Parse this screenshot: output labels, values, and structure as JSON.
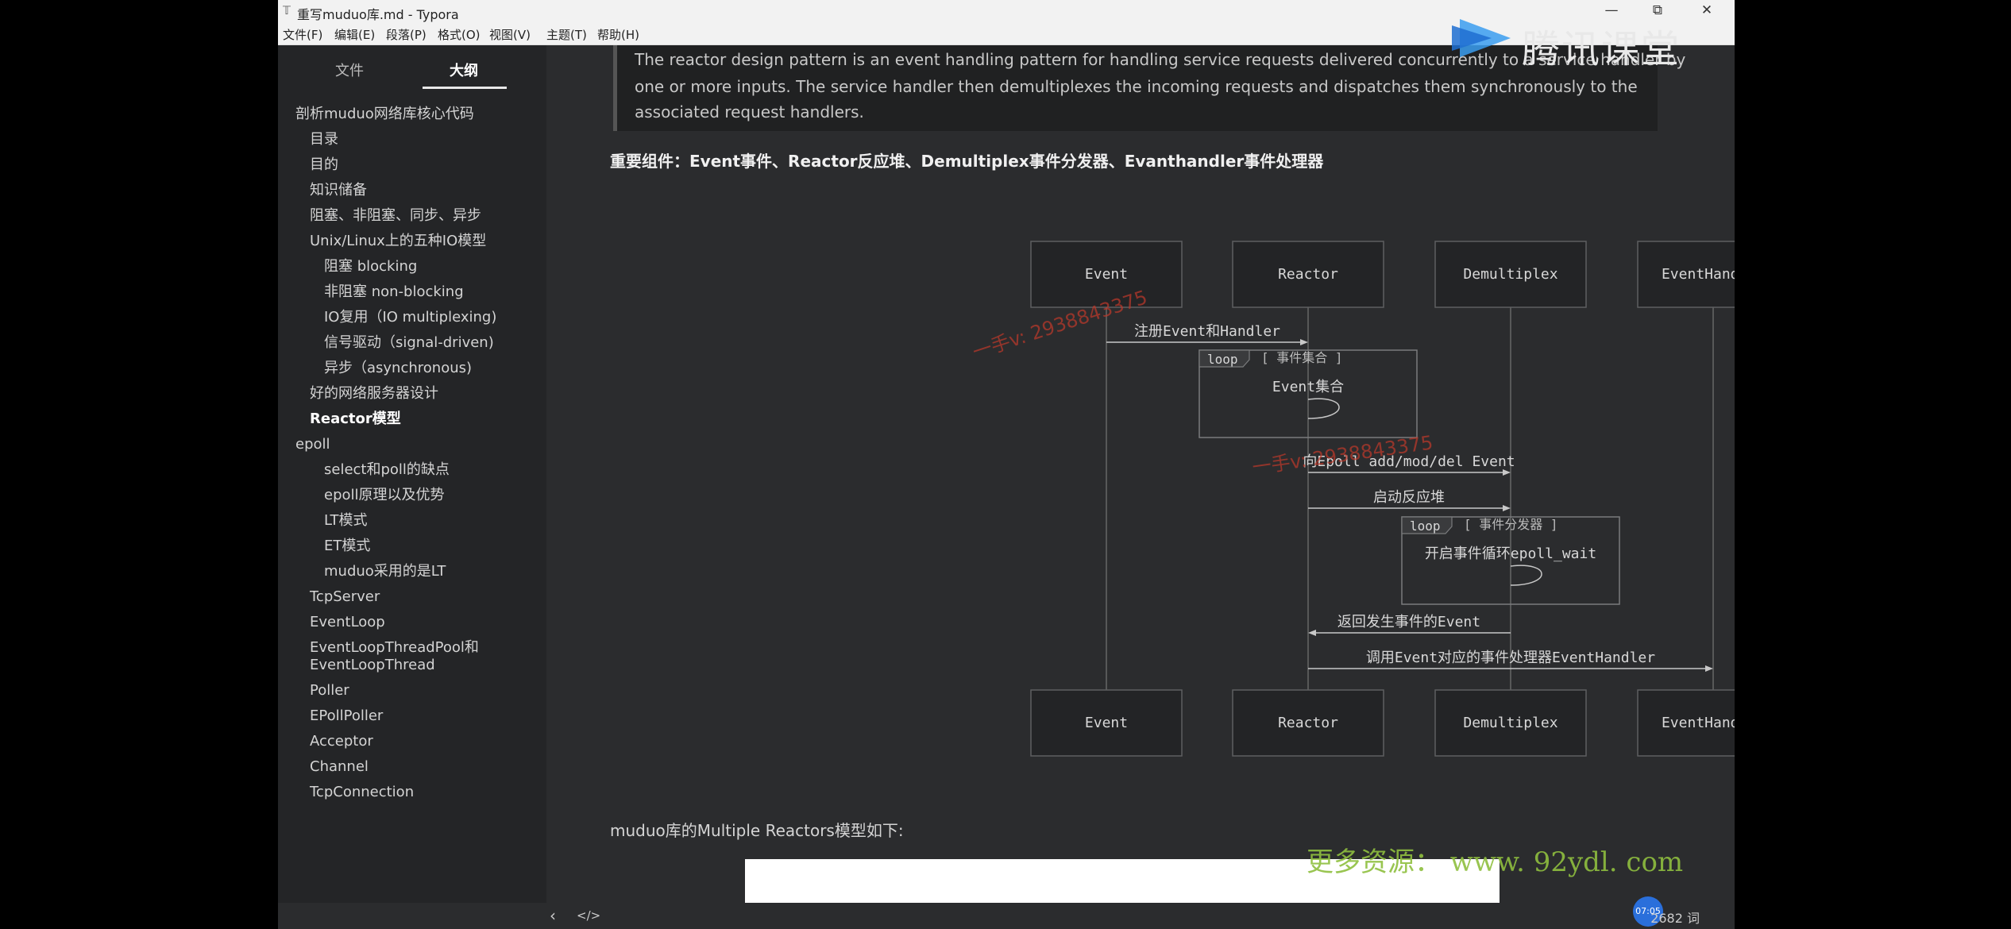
{
  "window": {
    "title": "重写muduo库.md - Typora",
    "minimize": "—",
    "maximize": "⧉",
    "close": "✕"
  },
  "menu": [
    "文件(F)",
    "编辑(E)",
    "段落(P)",
    "格式(O)",
    "视图(V)",
    "主题(T)",
    "帮助(H)"
  ],
  "sidebar": {
    "tabs": [
      "文件",
      "大纲"
    ],
    "active_tab": "大纲",
    "items": [
      {
        "label": "剖析muduo网络库核心代码",
        "level": 1
      },
      {
        "label": "目录",
        "level": 2
      },
      {
        "label": "目的",
        "level": 2
      },
      {
        "label": "知识储备",
        "level": 2
      },
      {
        "label": "阻塞、非阻塞、同步、异步",
        "level": 2
      },
      {
        "label": "Unix/Linux上的五种IO模型",
        "level": 2
      },
      {
        "label": "阻塞 blocking",
        "level": 3
      },
      {
        "label": "非阻塞 non-blocking",
        "level": 3
      },
      {
        "label": "IO复用（IO multiplexing)",
        "level": 3
      },
      {
        "label": "信号驱动（signal-driven)",
        "level": 3
      },
      {
        "label": "异步（asynchronous)",
        "level": 3
      },
      {
        "label": "好的网络服务器设计",
        "level": 2
      },
      {
        "label": "Reactor模型",
        "level": 2,
        "active": true
      },
      {
        "label": "epoll",
        "level": 1
      },
      {
        "label": "select和poll的缺点",
        "level": 3
      },
      {
        "label": "epoll原理以及优势",
        "level": 3
      },
      {
        "label": "LT模式",
        "level": 3
      },
      {
        "label": "ET模式",
        "level": 3
      },
      {
        "label": "muduo采用的是LT",
        "level": 3
      },
      {
        "label": "TcpServer",
        "level": 2
      },
      {
        "label": "EventLoop",
        "level": 2
      },
      {
        "label": "EventLoopThreadPool和\nEventLoopThread",
        "level": 2
      },
      {
        "label": "Poller",
        "level": 2
      },
      {
        "label": "EPollPoller",
        "level": 2
      },
      {
        "label": "Acceptor",
        "level": 2
      },
      {
        "label": "Channel",
        "level": 2
      },
      {
        "label": "TcpConnection",
        "level": 2
      }
    ]
  },
  "document": {
    "quote_lines": [
      "The reactor design pattern is an event handling pattern for handling service requests delivered concurrently to a service handler by",
      "one or more inputs. The service handler then demultiplexes the incoming requests and dispatches them synchronously to the",
      "associated request handlers."
    ],
    "components_heading": "重要组件：Event事件、Reactor反应堆、Demultiplex事件分发器、Evanthandler事件处理器",
    "after_paragraph": "muduo库的Multiple Reactors模型如下:"
  },
  "diagram": {
    "participants": [
      "Event",
      "Reactor",
      "Demultiplex",
      "EventHandler"
    ],
    "messages": [
      "注册Event和Handler",
      "向Epoll add/mod/del Event",
      "启动反应堆",
      "返回发生事件的Event",
      "调用Event对应的事件处理器EventHandler"
    ],
    "loops": [
      {
        "tag": "loop",
        "label": "[ 事件集合 ]",
        "body": "Event集合"
      },
      {
        "tag": "loop",
        "label": "[ 事件分发器 ]",
        "body": "开启事件循环epoll_wait"
      }
    ],
    "watermarks": [
      "一手v: 2938843375",
      "一手v: 2938843375"
    ]
  },
  "statusbar": {
    "back_icon": "‹",
    "source_icon": "</>",
    "time": "07:05",
    "word_count": "2682 词"
  },
  "overlay": {
    "brand_text": "腾讯课堂",
    "site_watermark": "更多资源： www. 92ydl. com"
  },
  "colors": {
    "sidebar_bg": "#242527",
    "content_bg": "#2b2c2e",
    "accent_blue": "#2a6fdb"
  }
}
